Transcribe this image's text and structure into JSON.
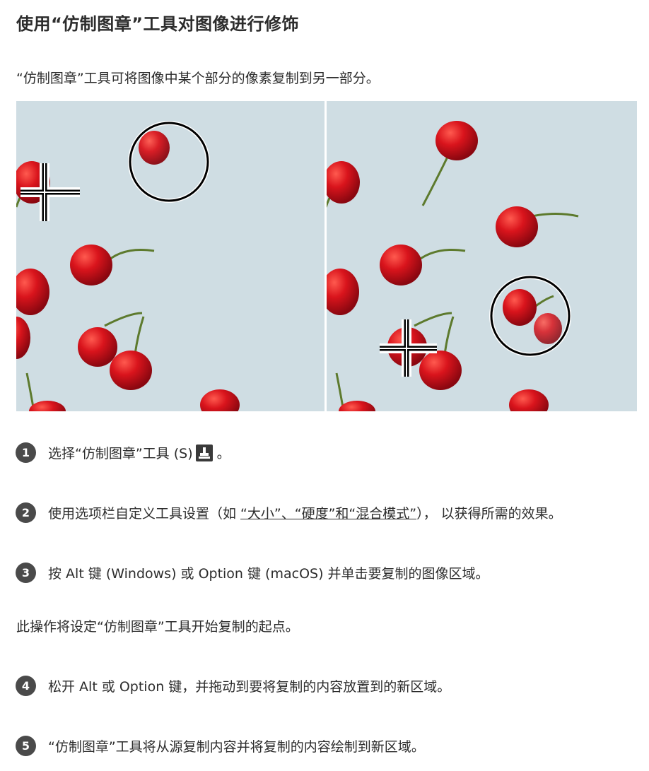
{
  "title": "使用“仿制图章”工具对图像进行修饰",
  "intro": "“仿制图章”工具可将图像中某个部分的像素复制到另一部分。",
  "steps": [
    {
      "num": "1",
      "text": "选择“仿制图章”工具 (S)",
      "suffix": "。",
      "icon": "stamp-tool-icon"
    },
    {
      "num": "2",
      "text_before": "使用选项栏自定义工具设置（如 ",
      "link": "“大小”、“硬度”和“混合模式”",
      "text_after": "），  以获得所需的效果。"
    },
    {
      "num": "3",
      "text": "按 Alt 键 (Windows) 或 Option 键 (macOS) 并单击要复制的图像区域。"
    },
    {
      "num": "4",
      "text": "松开 Alt 或 Option 键，并拖动到要将复制的内容放置到的新区域。"
    },
    {
      "num": "5",
      "text": "“仿制图章”工具将从源复制内容并将复制的内容绘制到新区域。"
    }
  ],
  "note": "此操作将设定“仿制图章”工具开始复制的起点。",
  "colors": {
    "background_image": "#cfdde3",
    "cherry": "#d21f26",
    "badge": "#4a4a4a"
  }
}
